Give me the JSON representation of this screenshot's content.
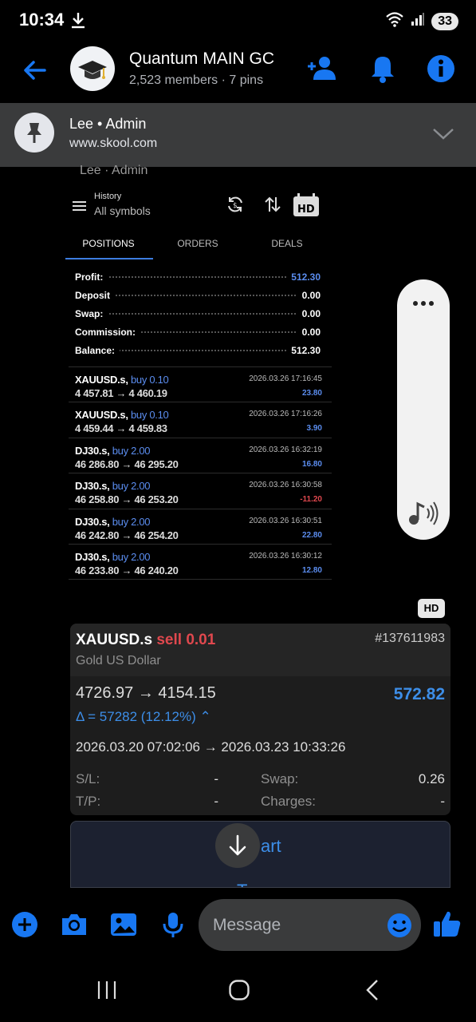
{
  "status_bar": {
    "time": "10:34",
    "battery": "33"
  },
  "header": {
    "title": "Quantum MAIN GC",
    "subtitle": "2,523 members · 7 pins"
  },
  "pinned": {
    "title": "Lee • Admin",
    "url": "www.skool.com"
  },
  "message": {
    "sender_faded": "Lee · Admin",
    "screenshot": {
      "history_label": "History",
      "filter_label": "All symbols",
      "tabs": [
        "POSITIONS",
        "ORDERS",
        "DEALS"
      ],
      "summary": [
        {
          "label": "Profit:",
          "value": "512.30"
        },
        {
          "label": "Deposit",
          "value": "0.00"
        },
        {
          "label": "Swap:",
          "value": "0.00"
        },
        {
          "label": "Commission:",
          "value": "0.00"
        },
        {
          "label": "Balance:",
          "value": "512.30"
        }
      ],
      "trades": [
        {
          "symbol": "XAUUSD.s,",
          "side": "buy 0.10",
          "prices": "4 457.81 → 4 460.19",
          "time": "2026.03.26 17:16:45",
          "profit": "23.80"
        },
        {
          "symbol": "XAUUSD.s,",
          "side": "buy 0.10",
          "prices": "4 459.44 → 4 459.83",
          "time": "2026.03.26 17:16:26",
          "profit": "3.90"
        },
        {
          "symbol": "DJ30.s,",
          "side": "buy 2.00",
          "prices": "46 286.80 → 46 295.20",
          "time": "2026.03.26 16:32:19",
          "profit": "16.80"
        },
        {
          "symbol": "DJ30.s,",
          "side": "buy 2.00",
          "prices": "46 258.80 → 46 253.20",
          "time": "2026.03.26 16:30:58",
          "profit": "-11.20"
        },
        {
          "symbol": "DJ30.s,",
          "side": "buy 2.00",
          "prices": "46 242.80 → 46 254.20",
          "time": "2026.03.26 16:30:51",
          "profit": "22.80"
        },
        {
          "symbol": "DJ30.s,",
          "side": "buy 2.00",
          "prices": "46 233.80 → 46 240.20",
          "time": "2026.03.26 16:30:12",
          "profit": "12.80"
        }
      ]
    },
    "hd_badge": "HD"
  },
  "trade_card": {
    "symbol": "XAUUSD.s",
    "side": "sell 0.01",
    "ticket": "#137611983",
    "name": "Gold US Dollar",
    "prices": "4726.97 → 4154.15",
    "profit": "572.82",
    "delta": "Δ = 57282 (12.12%) ⌃",
    "dates": "2026.03.20 07:02:06 → 2026.03.23 10:33:26",
    "sl_label": "S/L:",
    "sl_value": "-",
    "tp_label": "T/P:",
    "tp_value": "-",
    "swap_label": "Swap:",
    "swap_value": "0.26",
    "charges_label": "Charges:",
    "charges_value": "-"
  },
  "next_card": {
    "partial_text": "art",
    "partial_text2": "T..."
  },
  "composer": {
    "placeholder": "Message"
  },
  "colors": {
    "accent": "#1877f2",
    "profit_blue": "#3d8ee8",
    "loss_red": "#e0484e"
  }
}
